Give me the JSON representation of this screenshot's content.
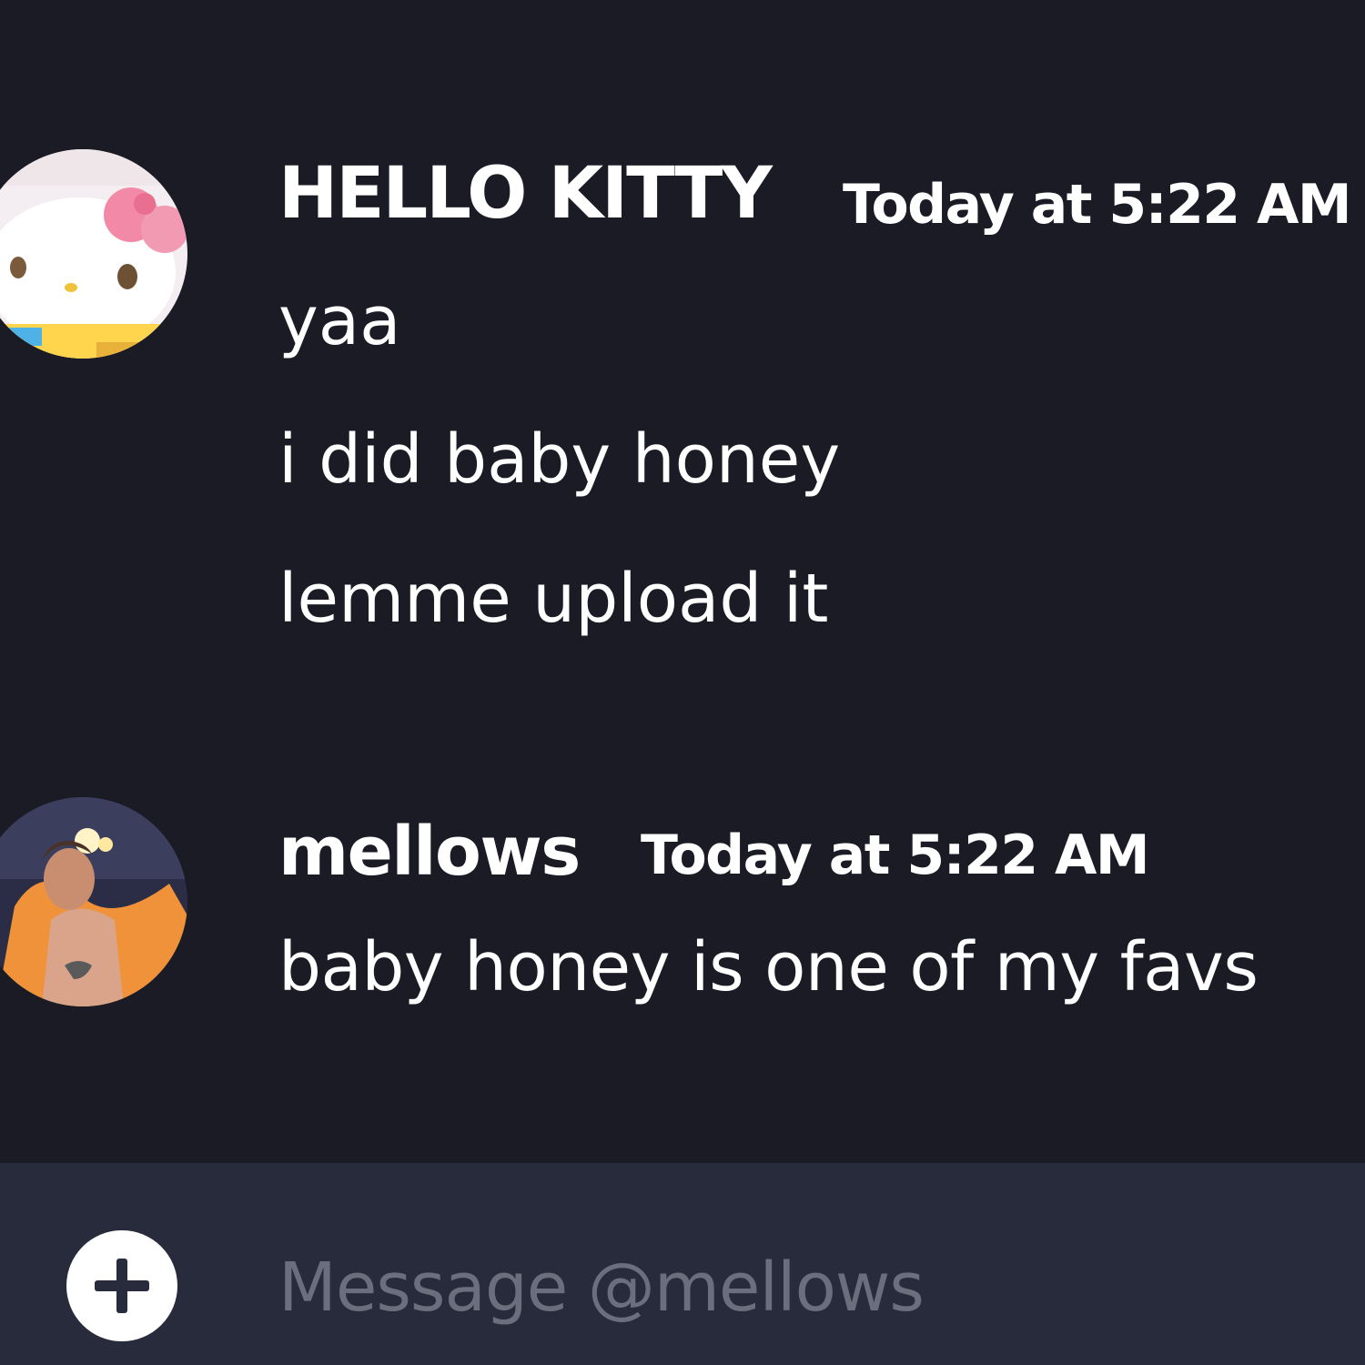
{
  "messages": [
    {
      "author": "HELLO KITTY",
      "timestamp": "Today at 5:22 AM",
      "avatar_icon": "hello-kitty-avatar",
      "lines": [
        "yaa",
        "i did baby honey",
        "lemme upload it"
      ]
    },
    {
      "author": "mellows",
      "timestamp": "Today at 5:22 AM",
      "avatar_icon": "performer-avatar",
      "lines": [
        "baby honey is one of my favs"
      ]
    }
  ],
  "composer": {
    "placeholder": "Message @mellows",
    "add_icon": "plus-icon"
  },
  "colors": {
    "background": "#1a1b25",
    "composer_background": "#282b3b",
    "text": "#ffffff",
    "placeholder": "#6b6e7c"
  }
}
